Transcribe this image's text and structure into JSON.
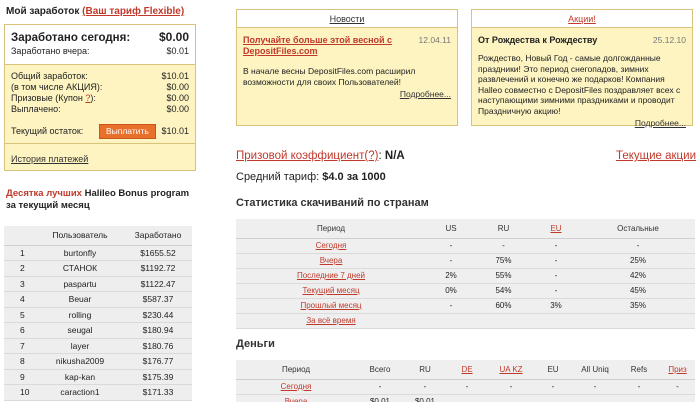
{
  "earnings": {
    "header": "Мой заработок",
    "tariff_link": "(Ваш тариф Flexible)",
    "today_label": "Заработано сегодня:",
    "today_value": "$0.00",
    "yesterday_label": "Заработано вчера:",
    "yesterday_value": "$0.01",
    "rows": [
      {
        "label": "Общий заработок:",
        "value": "$10.01"
      },
      {
        "label": "(в том числе АКЦИЯ):",
        "value": "$0.00"
      },
      {
        "label_pre": "Призовые (Купон ",
        "label_link": "?",
        "label_post": "):",
        "value": "$0.00"
      },
      {
        "label": "Выплачено:",
        "value": "$0.00"
      }
    ],
    "balance_label": "Текущий остаток:",
    "pay_button": "Выплатить",
    "balance_value": "$10.01",
    "history_link": "История платежей"
  },
  "top10": {
    "title_red": "Десятка лучших",
    "title_rest": " Halileo Bonus program",
    "title_line2": "за текущий месяц",
    "col_user": "Пользователь",
    "col_earned": "Заработано",
    "rows": [
      {
        "n": "1",
        "user": "burtonfly",
        "earned": "$1655.52"
      },
      {
        "n": "2",
        "user": "СТАНОК",
        "earned": "$1192.72"
      },
      {
        "n": "3",
        "user": "paspartu",
        "earned": "$1122.47"
      },
      {
        "n": "4",
        "user": "Beuar",
        "earned": "$587.37"
      },
      {
        "n": "5",
        "user": "rolling",
        "earned": "$230.44"
      },
      {
        "n": "6",
        "user": "seugal",
        "earned": "$180.94"
      },
      {
        "n": "7",
        "user": "layer",
        "earned": "$180.76"
      },
      {
        "n": "8",
        "user": "nikusha2009",
        "earned": "$176.77"
      },
      {
        "n": "9",
        "user": "kap-kan",
        "earned": "$175.39"
      },
      {
        "n": "10",
        "user": "caraction1",
        "earned": "$171.33"
      }
    ]
  },
  "news": {
    "tab": "Новости",
    "title": "Получайте больше этой весной с DepositFiles.com",
    "date": "12.04.11",
    "text": "В начале весны DepositFiles.com расширил возможности для своих Пользователей!",
    "more": "Подробнее..."
  },
  "promo": {
    "tab": "Акции!",
    "title": "От Рождества к Рождеству",
    "date": "25.12.10",
    "text": "Рождество, Новый Год - самые долгожданные праздники! Это период снегопадов, зимних развлечений и конечно же подарков! Компания Halleo совместно с DepositFiles поздравляет всех с наступающими зимними праздниками и проводит Праздничную акцию!",
    "more": "Подробнее..."
  },
  "prize": {
    "label": "Призовой коэффициент",
    "help": "(?)",
    "colon": ":",
    "value": "N/A",
    "current_promos": "Текущие акции"
  },
  "avg": {
    "label": "Средний тариф:",
    "value": "$4.0 за 1000"
  },
  "stats": {
    "title": "Статистика скачиваний по странам",
    "cols": [
      "Период",
      "US",
      "RU",
      "EU",
      "Остальные"
    ],
    "rows": [
      [
        "Сегодня",
        "-",
        "-",
        "-",
        "-"
      ],
      [
        "Вчера",
        "-",
        "75%",
        "-",
        "25%"
      ],
      [
        "Последние 7 дней",
        "2%",
        "55%",
        "-",
        "42%"
      ],
      [
        "Текущий месяц",
        "0%",
        "54%",
        "-",
        "45%"
      ],
      [
        "Прошлый месяц",
        "-",
        "60%",
        "3%",
        "35%"
      ],
      [
        "За всё время",
        "",
        "",
        "",
        ""
      ]
    ]
  },
  "money": {
    "title": "Деньги",
    "cols": [
      "Период",
      "Всего",
      "RU",
      "DE",
      "UA KZ",
      "EU",
      "All Uniq",
      "Refs",
      "Приз"
    ],
    "rows": [
      [
        "Сегодня",
        "-",
        "-",
        "-",
        "-",
        "-",
        "-",
        "-",
        "-"
      ],
      [
        "Вчера",
        "$0.01",
        "$0.01",
        "",
        "",
        "",
        "",
        "",
        ""
      ]
    ]
  }
}
